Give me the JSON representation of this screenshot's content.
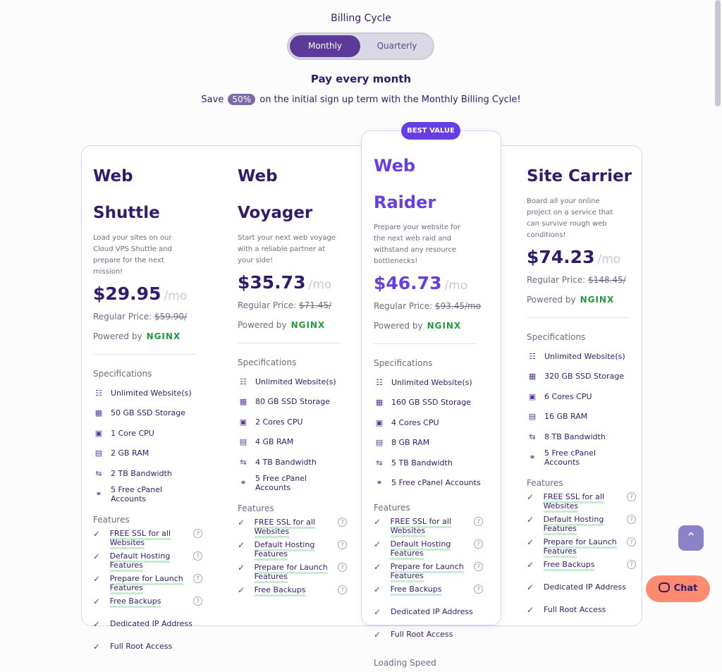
{
  "billing": {
    "title": "Billing Cycle",
    "options": [
      "Monthly",
      "Quarterly"
    ],
    "selected": "Monthly",
    "pay_text": "Pay every month",
    "save_prefix": "Save",
    "save_pill": "50%",
    "save_suffix": "on the initial sign up term with the Monthly Billing Cycle!"
  },
  "best_value": "BEST VALUE",
  "labels": {
    "specs": "Specifications",
    "features": "Features",
    "powered": "Powered by",
    "nginx": "NGINX",
    "per": "/mo",
    "regular_prefix": "Regular Price:",
    "loading_speed": "Loading Speed"
  },
  "plans": [
    {
      "name": "Web Shuttle",
      "desc": "Load your sites on our Cloud VPS Shuttle and prepare for the next mission!",
      "price": "$29.95",
      "regular": "$59.90/",
      "specs": [
        "Unlimited Website(s)",
        "50 GB SSD Storage",
        "1 Core CPU",
        "2 GB RAM",
        "2 TB Bandwidth",
        "5 Free cPanel Accounts"
      ],
      "features": [
        "FREE SSL for all Websites",
        "Default Hosting Features",
        "Prepare for Launch Features",
        "Free Backups",
        "Dedicated IP Address",
        "Full Root Access"
      ]
    },
    {
      "name": "Web Voyager",
      "desc": "Start your next web voyage with a reliable partner at your side!",
      "price": "$35.73",
      "regular": "$71.45/",
      "specs": [
        "Unlimited Website(s)",
        "80 GB SSD Storage",
        "2 Cores CPU",
        "4 GB RAM",
        "4 TB Bandwidth",
        "5 Free cPanel Accounts"
      ],
      "features": [
        "FREE SSL for all Websites",
        "Default Hosting Features",
        "Prepare for Launch Features",
        "Free Backups"
      ]
    },
    {
      "name": "Web Raider",
      "desc": "Prepare your website for the next web raid and withstand any resource bottlenecks!",
      "price": "$46.73",
      "regular": "$93.45/mo",
      "specs": [
        "Unlimited Website(s)",
        "160 GB SSD Storage",
        "4 Cores CPU",
        "8 GB RAM",
        "5 TB Bandwidth",
        "5 Free cPanel Accounts"
      ],
      "features": [
        "FREE SSL for all Websites",
        "Default Hosting Features",
        "Prepare for Launch Features",
        "Free Backups",
        "Dedicated IP Address",
        "Full Root Access"
      ]
    },
    {
      "name": "Site Carrier",
      "desc": "Board all your online project on a service that can survive rough web conditions!",
      "price": "$74.23",
      "regular": "$148.45/",
      "specs": [
        "Unlimited Website(s)",
        "320 GB SSD Storage",
        "6 Cores CPU",
        "16 GB RAM",
        "8 TB Bandwidth",
        "5 Free cPanel Accounts"
      ],
      "features": [
        "FREE SSL for all Websites",
        "Default Hosting Features",
        "Prepare for Launch Features",
        "Free Backups",
        "Dedicated IP Address",
        "Full Root Access"
      ]
    }
  ],
  "chat_label": "Chat",
  "colors": {
    "accent": "#673de6",
    "dark": "#2f1c6a",
    "toggle_active": "#5b3a99",
    "chat": "#ff8a70",
    "nginx": "#1e9b3a"
  }
}
